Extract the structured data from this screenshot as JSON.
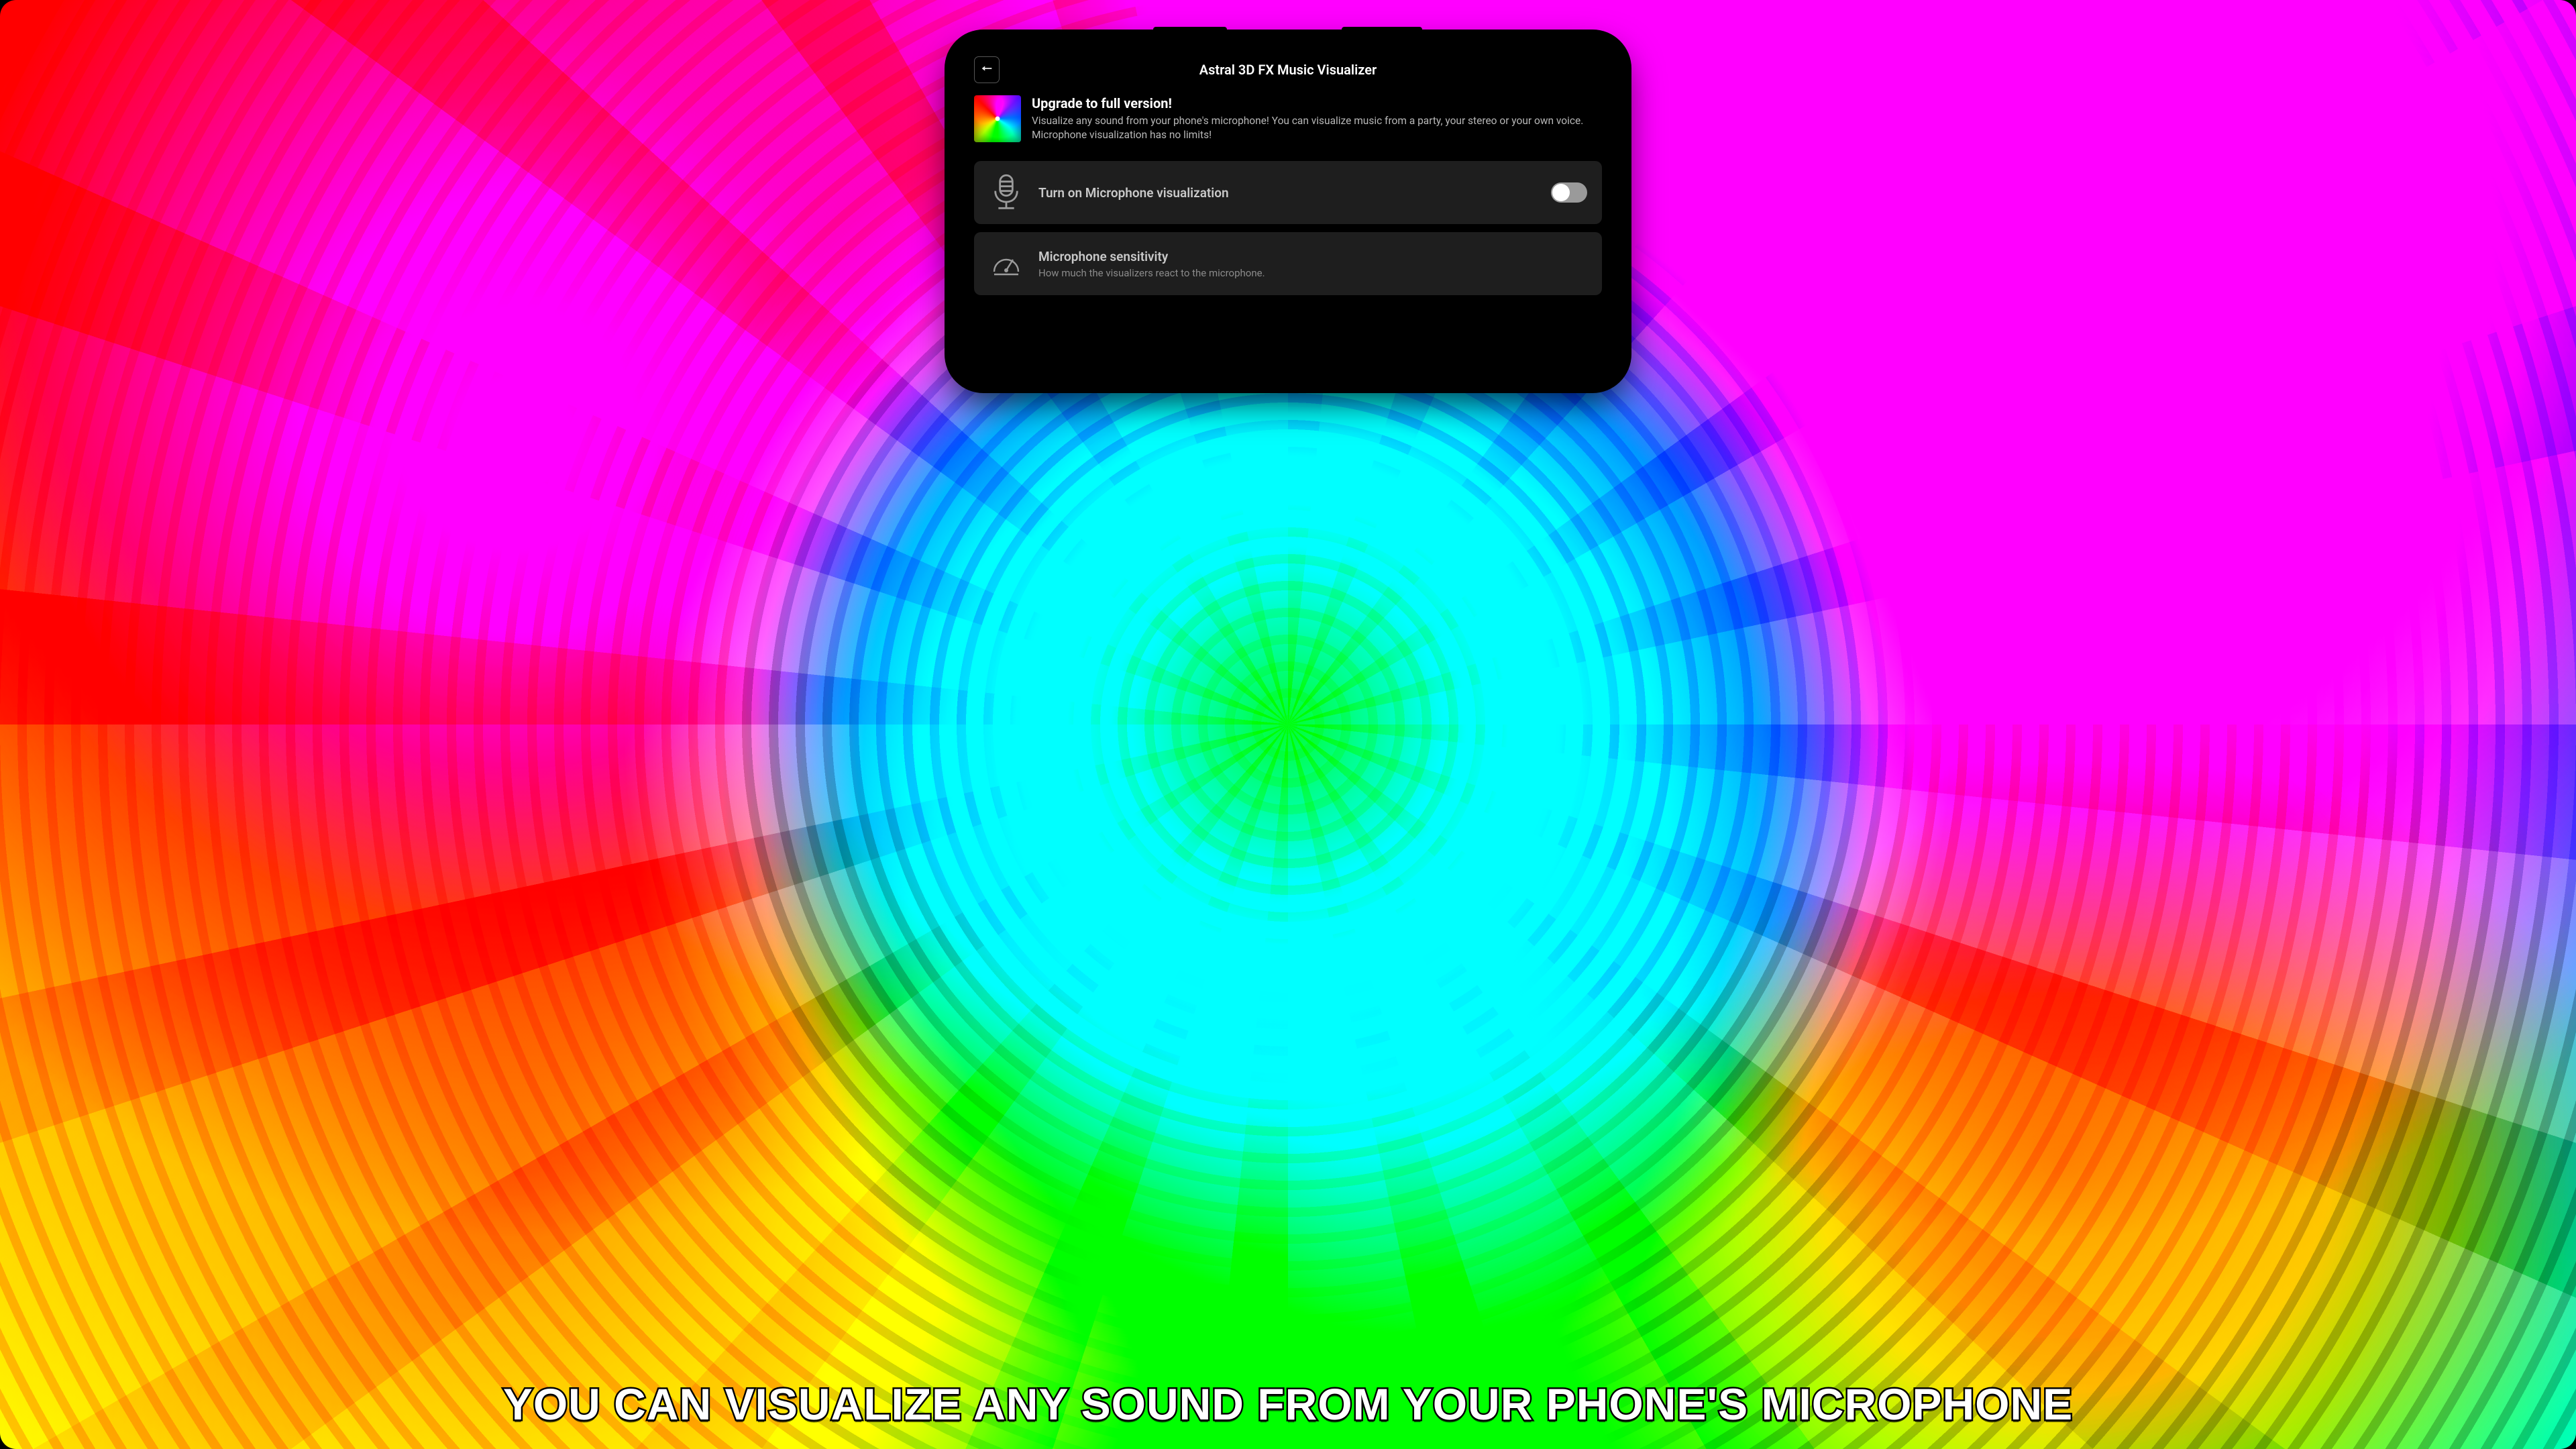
{
  "header": {
    "title": "Astral 3D FX Music Visualizer"
  },
  "promo": {
    "heading": "Upgrade to full version!",
    "body": "Visualize any sound from your phone's microphone! You can visualize music from a party, your stereo or your own voice. Microphone visualization has no limits!"
  },
  "rows": {
    "mic_toggle": {
      "title": "Turn on Microphone visualization",
      "value": false
    },
    "mic_sensitivity": {
      "title": "Microphone sensitivity",
      "sub": "How much the visualizers react to the microphone."
    }
  },
  "caption": "YOU CAN VISUALIZE ANY SOUND FROM YOUR PHONE'S MICROPHONE"
}
